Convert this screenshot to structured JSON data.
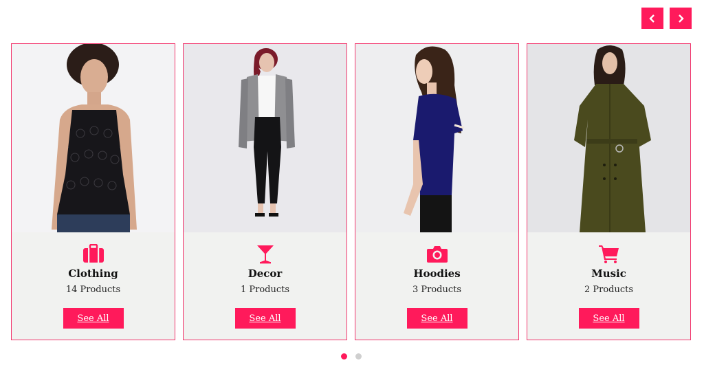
{
  "colors": {
    "accent": "#ff1a5b",
    "card_bg": "#f1f2f0",
    "dot_inactive": "#cfcfcf"
  },
  "nav": {
    "prev_icon": "chevron-left-icon",
    "next_icon": "chevron-right-icon"
  },
  "cards": [
    {
      "title": "Clothing",
      "count": "14 Products",
      "button": "See All",
      "icon": "briefcase-icon",
      "image": "woman-black-lace-top-photo"
    },
    {
      "title": "Decor",
      "count": "1 Products",
      "button": "See All",
      "icon": "cocktail-glass-icon",
      "image": "woman-grey-cardigan-photo"
    },
    {
      "title": "Hoodies",
      "count": "3 Products",
      "button": "See All",
      "icon": "camera-icon",
      "image": "woman-navy-tshirt-photo"
    },
    {
      "title": "Music",
      "count": "2 Products",
      "button": "See All",
      "icon": "shopping-cart-icon",
      "image": "woman-olive-trench-coat-photo"
    }
  ],
  "pagination": {
    "total": 2,
    "active": 1
  }
}
